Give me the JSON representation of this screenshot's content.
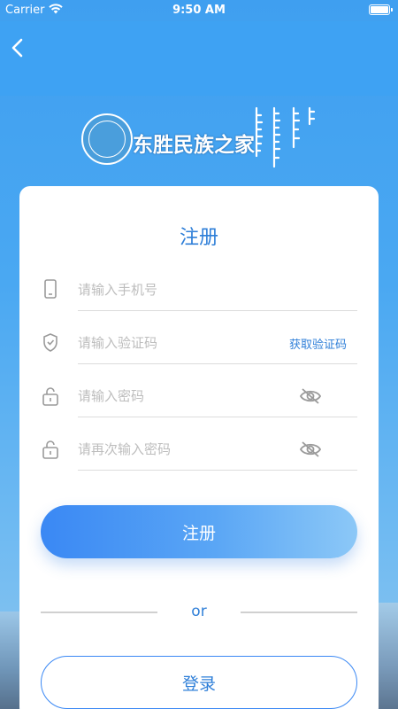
{
  "status_bar": {
    "carrier": "Carrier",
    "time": "9:50 AM",
    "battery_level": 1.0
  },
  "header": {
    "back_icon": "chevron-left-icon",
    "brand_name": "东胜民族之家",
    "emblem_icon": "emblem-icon",
    "mongolian_script": "ᠳ᠋ᠦᠩᠱᠧᠩ ᠦᠨᠳᠦᠰᠦᠲᠡᠨ ᠦ ᠭᠡᠷ"
  },
  "form": {
    "title": "注册",
    "phone": {
      "placeholder": "请输入手机号",
      "icon": "phone-icon"
    },
    "code": {
      "placeholder": "请输入验证码",
      "icon": "shield-icon",
      "get_code_label": "获取验证码"
    },
    "password": {
      "placeholder": "请输入密码",
      "icon": "lock-icon",
      "toggle_icon": "eye-off-icon"
    },
    "confirm_password": {
      "placeholder": "请再次输入密码",
      "icon": "lock-icon",
      "toggle_icon": "eye-off-icon"
    },
    "register_label": "注册",
    "or_label": "or",
    "login_label": "登录"
  },
  "colors": {
    "accent": "#2f7fd8",
    "background": "#4aa8f2",
    "card": "#ffffff"
  }
}
